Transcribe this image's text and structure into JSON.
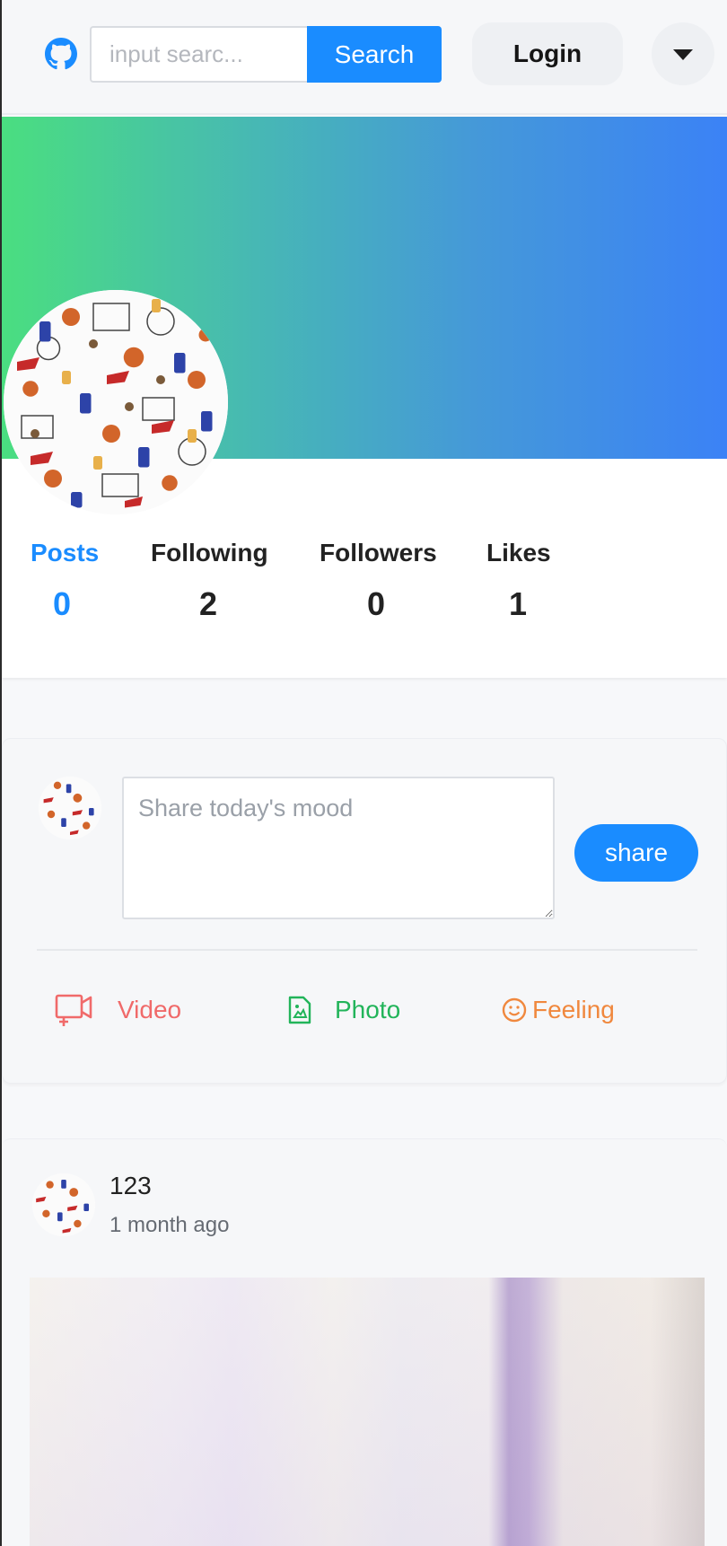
{
  "header": {
    "logo_icon": "github-icon",
    "search_placeholder": "input searc...",
    "search_button": "Search",
    "login_button": "Login",
    "dropdown_icon": "caret-down-icon"
  },
  "profile": {
    "cover_colors": [
      "#4ade80",
      "#3b82f6"
    ],
    "avatar_icon": "basketball-pattern-avatar",
    "stats": [
      {
        "label": "Posts",
        "value": "0",
        "active": true
      },
      {
        "label": "Following",
        "value": "2"
      },
      {
        "label": "Followers",
        "value": "0"
      },
      {
        "label": "Likes",
        "value": "1"
      }
    ]
  },
  "composer": {
    "placeholder": "Share today's mood",
    "share_button": "share",
    "actions": [
      {
        "label": "Video",
        "icon": "video-icon",
        "color": "#f06a6a"
      },
      {
        "label": "Photo",
        "icon": "image-file-icon",
        "color": "#22b45a"
      },
      {
        "label": "Feeling",
        "icon": "smile-icon",
        "color": "#f0883e"
      }
    ]
  },
  "post": {
    "username": "123",
    "time": "1 month ago"
  },
  "colors": {
    "accent": "#1a8cff"
  }
}
